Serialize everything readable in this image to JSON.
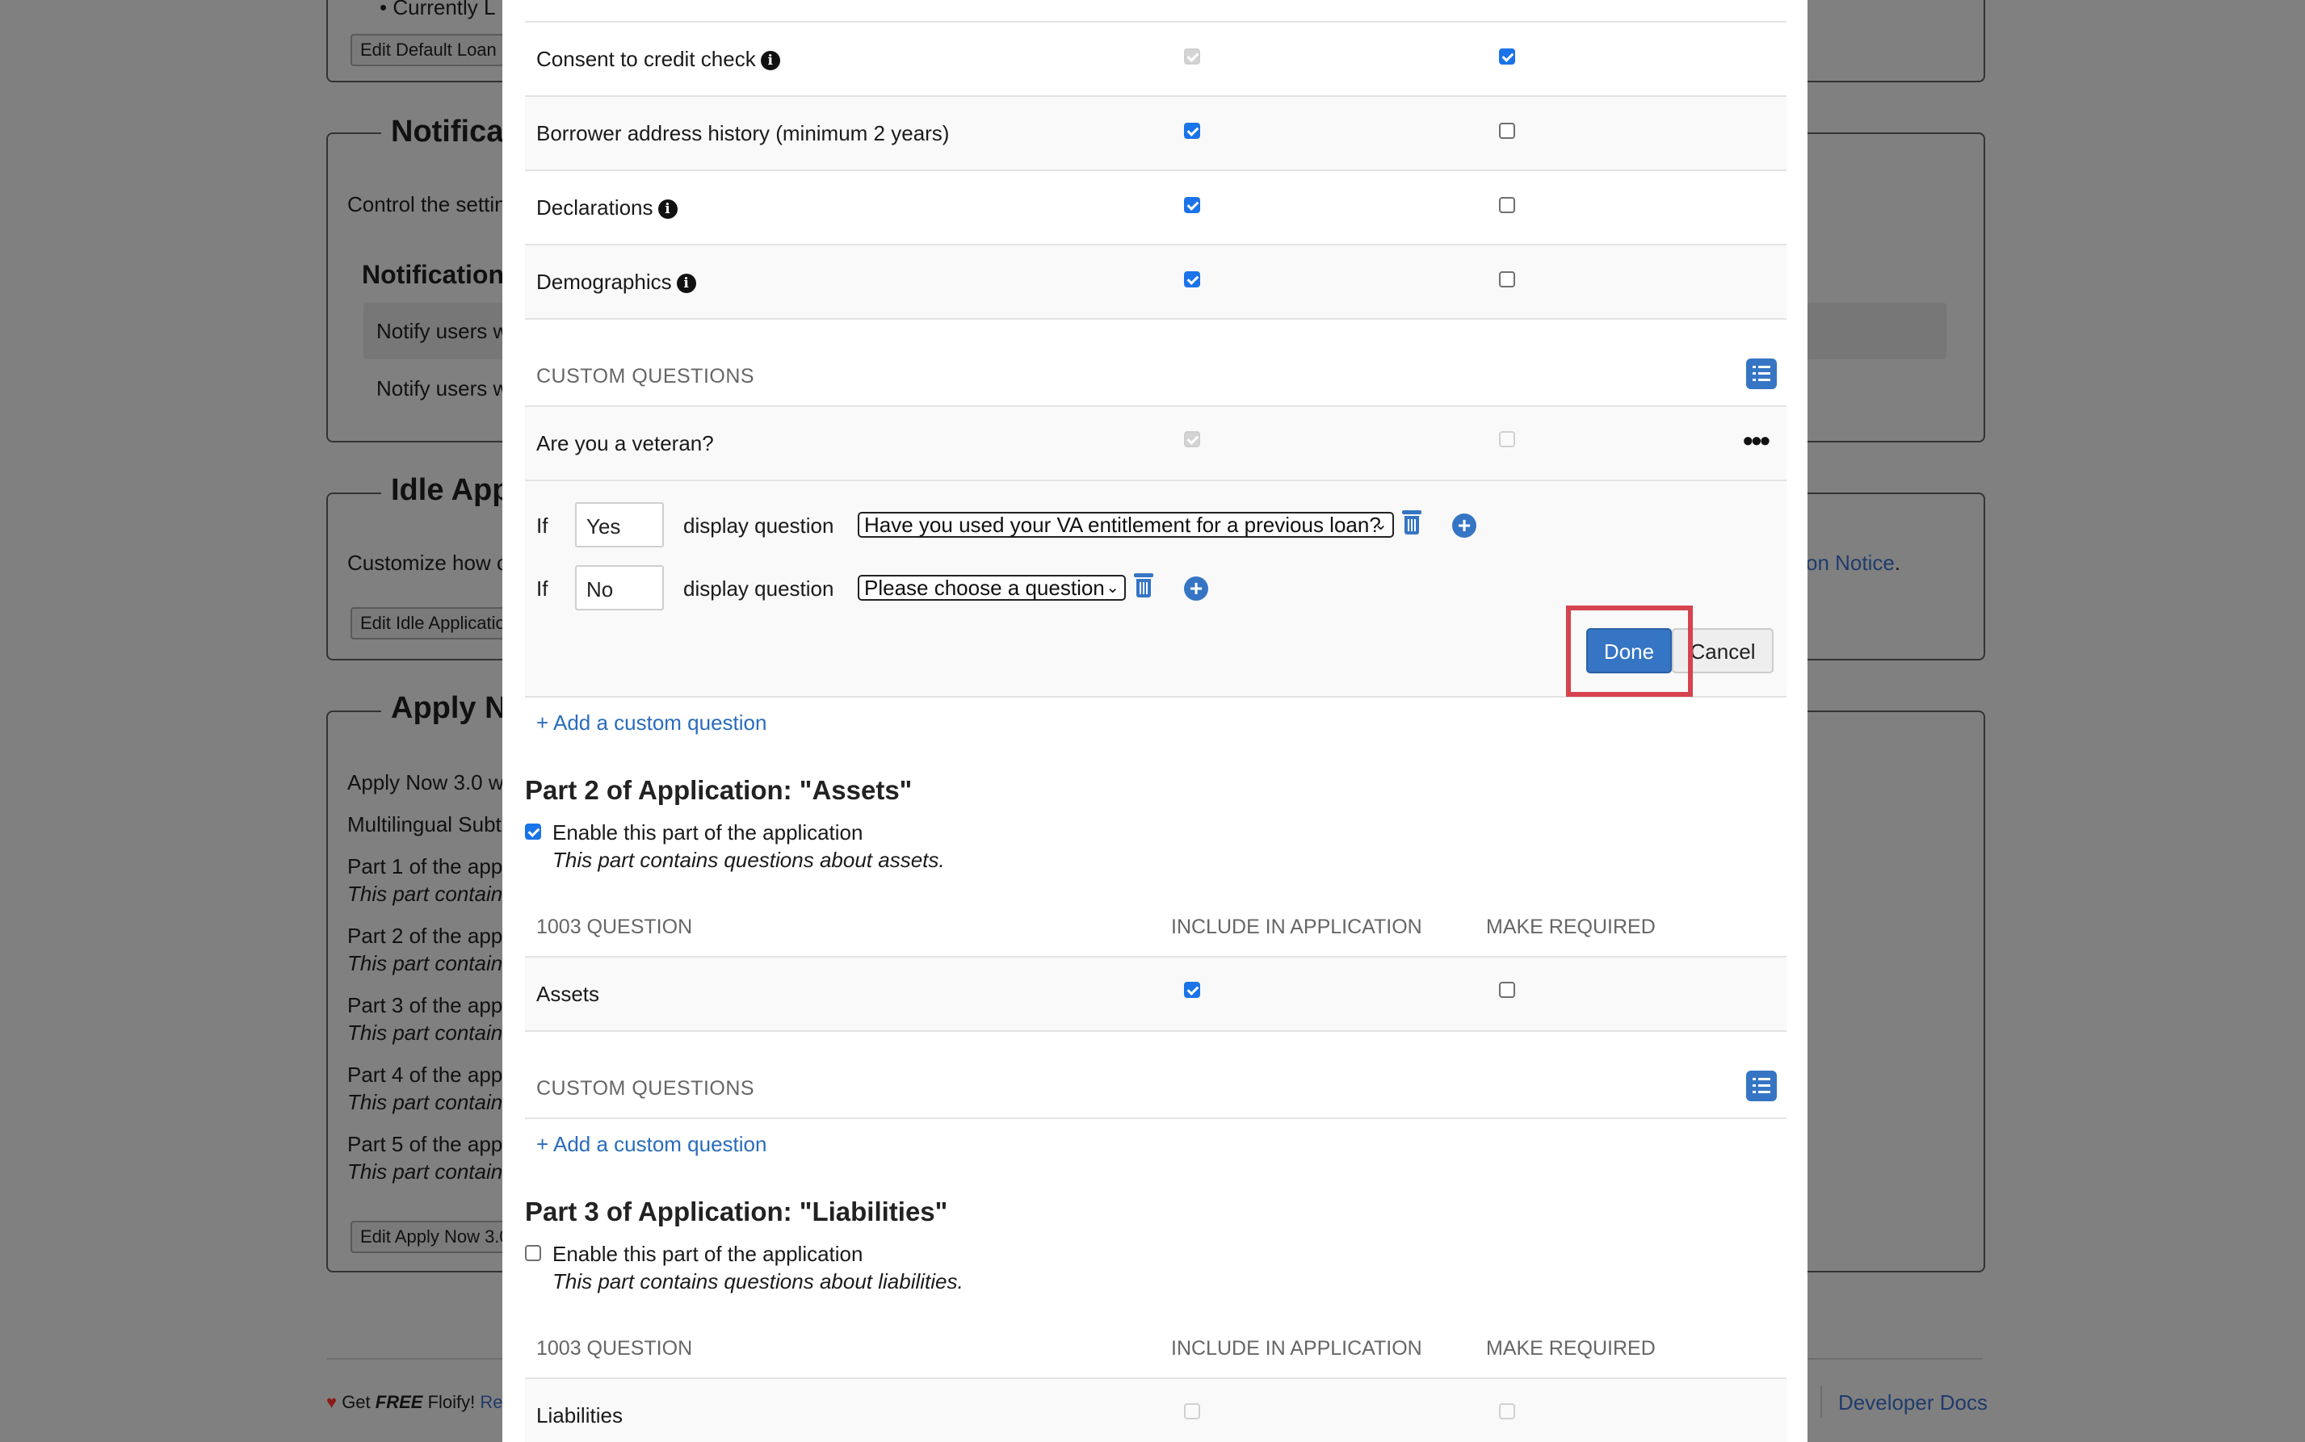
{
  "background": {
    "list_item_partial": "Currently L",
    "edit_default_loan": "Edit Default Loan C",
    "notifications": {
      "title": "Notifica",
      "description": "Control the settin",
      "subheading": "Notification",
      "notify_1": "Notify users w",
      "notify_2": "Notify users w"
    },
    "idle": {
      "title": "Idle App",
      "description": "Customize how c",
      "button": "Edit Idle Applicatio",
      "right_link": "on Notice",
      "right_link_suffix": "."
    },
    "apply_now": {
      "title": "Apply N",
      "lines": [
        "Apply Now 3.0 w",
        "Multilingual Subti",
        "Part 1 of the app",
        "This part contains",
        "Part 2 of the app",
        "This part contains",
        "Part 3 of the app",
        "This part contains",
        "Part 4 of the app",
        "This part contains",
        "Part 5 of the app",
        "This part contains"
      ],
      "button": "Edit Apply Now 3.0"
    },
    "footer": {
      "get": "Get",
      "free": "FREE",
      "floify": "Floify!",
      "re": "Re",
      "developer_docs": "Developer Docs"
    }
  },
  "modal": {
    "part1": {
      "questions": [
        {
          "label": "Consent to credit check",
          "info": true
        },
        {
          "label": "Borrower address history (minimum 2 years)",
          "info": false
        },
        {
          "label": "Declarations",
          "info": true
        },
        {
          "label": "Demographics",
          "info": true
        }
      ],
      "custom_questions_header": "CUSTOM QUESTIONS",
      "custom_question": "Are you a veteran?",
      "more_icon": "ellipsis-icon",
      "conditions": [
        {
          "if": "If",
          "value": "Yes",
          "display": "display question",
          "select": "Have you used your VA entitlement for a previous loan?"
        },
        {
          "if": "If",
          "value": "No",
          "display": "display question",
          "select": "Please choose a question"
        }
      ],
      "done": "Done",
      "cancel": "Cancel",
      "add_custom": "+ Add a custom question"
    },
    "part2": {
      "title": "Part 2 of Application: \"Assets\"",
      "enable_label": "Enable this part of the application",
      "enable_desc": "This part contains questions about assets.",
      "enabled": true,
      "col_question": "1003 QUESTION",
      "col_include": "INCLUDE IN APPLICATION",
      "col_required": "MAKE REQUIRED",
      "question": "Assets",
      "custom_questions_header": "CUSTOM QUESTIONS",
      "add_custom": "+ Add a custom question"
    },
    "part3": {
      "title": "Part 3 of Application: \"Liabilities\"",
      "enable_label": "Enable this part of the application",
      "enable_desc": "This part contains questions about liabilities.",
      "enabled": false,
      "col_question": "1003 QUESTION",
      "col_include": "INCLUDE IN APPLICATION",
      "col_required": "MAKE REQUIRED",
      "question": "Liabilities"
    }
  },
  "colors": {
    "accent": "#3575c4",
    "highlight": "#d6434e",
    "checkbox_on": "#1a73e8"
  }
}
